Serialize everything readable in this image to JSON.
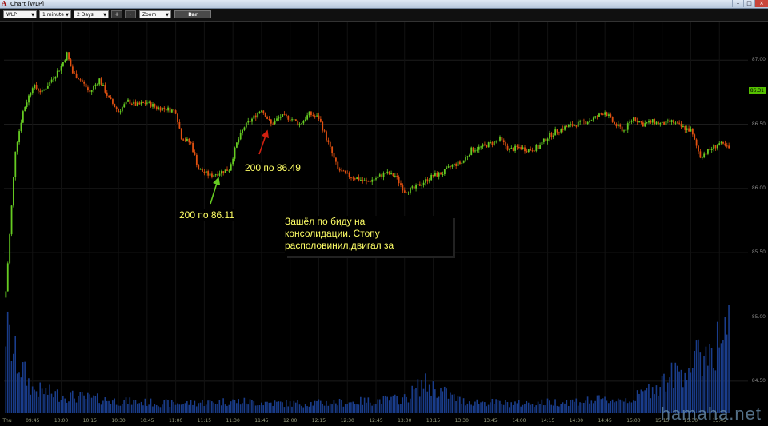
{
  "window": {
    "title": "Chart [WLP]",
    "minimize": "–",
    "maximize": "□",
    "close": "×"
  },
  "toolbar": {
    "symbol": "WLP",
    "interval": "1 minute",
    "range": "2 Days",
    "zoom_in": "+",
    "zoom_out": "-",
    "zoom": "Zoom",
    "chart_type": "Bar"
  },
  "price_axis": [
    "87.00",
    "86.50",
    "86.00",
    "85.50",
    "85.00",
    "84.50"
  ],
  "last_price": "86.31",
  "time_axis": [
    "Thu",
    "09:45",
    "10:00",
    "10:15",
    "10:30",
    "10:45",
    "11:00",
    "11:15",
    "11:30",
    "11:45",
    "12:00",
    "12:15",
    "12:30",
    "12:45",
    "13:00",
    "13:15",
    "13:30",
    "13:45",
    "14:00",
    "14:15",
    "14:30",
    "14:45",
    "15:00",
    "15:15",
    "15:30",
    "15:45"
  ],
  "annotations": {
    "buy": "200 по 86.11",
    "sell": "200 по 86.49",
    "comment_line1": "Зашёл по биду на",
    "comment_line2": "консолидации. Стопу",
    "comment_line3": "располовинил,двигал за"
  },
  "watermark": "hamaha.net",
  "colors": {
    "up": "#66cc22",
    "down": "#e05010",
    "volume": "#1a3d8c",
    "grid": "#1c1c1c",
    "note_text": "#ffff66"
  },
  "chart_data": {
    "type": "candlestick",
    "symbol": "WLP",
    "interval": "1 minute",
    "x_range": [
      "09:30",
      "16:00"
    ],
    "y_range": [
      84.25,
      87.3
    ],
    "y_ticks": [
      87.0,
      86.5,
      86.0,
      85.5,
      85.0,
      84.5
    ],
    "last_price": 86.31,
    "price_path": [
      [
        "09:31",
        85.2
      ],
      [
        "09:36",
        86.3
      ],
      [
        "09:40",
        86.6
      ],
      [
        "09:45",
        86.8
      ],
      [
        "09:50",
        86.75
      ],
      [
        "09:55",
        86.85
      ],
      [
        "10:00",
        86.95
      ],
      [
        "10:03",
        87.05
      ],
      [
        "10:06",
        86.9
      ],
      [
        "10:10",
        86.85
      ],
      [
        "10:15",
        86.75
      ],
      [
        "10:20",
        86.85
      ],
      [
        "10:25",
        86.7
      ],
      [
        "10:30",
        86.6
      ],
      [
        "10:35",
        86.68
      ],
      [
        "10:40",
        86.65
      ],
      [
        "10:45",
        86.67
      ],
      [
        "10:50",
        86.63
      ],
      [
        "10:55",
        86.62
      ],
      [
        "11:00",
        86.6
      ],
      [
        "11:03",
        86.4
      ],
      [
        "11:08",
        86.35
      ],
      [
        "11:12",
        86.15
      ],
      [
        "11:18",
        86.1
      ],
      [
        "11:22",
        86.12
      ],
      [
        "11:28",
        86.15
      ],
      [
        "11:32",
        86.35
      ],
      [
        "11:36",
        86.48
      ],
      [
        "11:42",
        86.57
      ],
      [
        "11:45",
        86.62
      ],
      [
        "11:50",
        86.5
      ],
      [
        "11:55",
        86.56
      ],
      [
        "12:00",
        86.55
      ],
      [
        "12:05",
        86.5
      ],
      [
        "12:10",
        86.58
      ],
      [
        "12:15",
        86.55
      ],
      [
        "12:20",
        86.35
      ],
      [
        "12:25",
        86.15
      ],
      [
        "12:30",
        86.1
      ],
      [
        "12:35",
        86.08
      ],
      [
        "12:40",
        86.05
      ],
      [
        "12:45",
        86.08
      ],
      [
        "12:50",
        86.12
      ],
      [
        "12:55",
        86.1
      ],
      [
        "13:00",
        85.98
      ],
      [
        "13:05",
        86.0
      ],
      [
        "13:10",
        86.05
      ],
      [
        "13:15",
        86.1
      ],
      [
        "13:20",
        86.12
      ],
      [
        "13:25",
        86.18
      ],
      [
        "13:30",
        86.2
      ],
      [
        "13:35",
        86.3
      ],
      [
        "13:40",
        86.32
      ],
      [
        "13:45",
        86.35
      ],
      [
        "13:50",
        86.38
      ],
      [
        "13:55",
        86.3
      ],
      [
        "14:00",
        86.32
      ],
      [
        "14:05",
        86.3
      ],
      [
        "14:10",
        86.32
      ],
      [
        "14:15",
        86.4
      ],
      [
        "14:20",
        86.45
      ],
      [
        "14:25",
        86.48
      ],
      [
        "14:30",
        86.5
      ],
      [
        "14:35",
        86.52
      ],
      [
        "14:40",
        86.55
      ],
      [
        "14:45",
        86.6
      ],
      [
        "14:50",
        86.5
      ],
      [
        "14:55",
        86.45
      ],
      [
        "15:00",
        86.55
      ],
      [
        "15:05",
        86.5
      ],
      [
        "15:10",
        86.52
      ],
      [
        "15:15",
        86.5
      ],
      [
        "15:20",
        86.52
      ],
      [
        "15:25",
        86.48
      ],
      [
        "15:30",
        86.45
      ],
      [
        "15:35",
        86.25
      ],
      [
        "15:40",
        86.3
      ],
      [
        "15:45",
        86.35
      ],
      [
        "15:50",
        86.31
      ]
    ],
    "volume_path": [
      [
        "09:31",
        0.7
      ],
      [
        "09:35",
        0.5
      ],
      [
        "09:45",
        0.2
      ],
      [
        "10:00",
        0.15
      ],
      [
        "10:30",
        0.1
      ],
      [
        "11:00",
        0.08
      ],
      [
        "11:30",
        0.1
      ],
      [
        "12:00",
        0.08
      ],
      [
        "12:30",
        0.09
      ],
      [
        "13:00",
        0.12
      ],
      [
        "13:10",
        0.25
      ],
      [
        "13:30",
        0.1
      ],
      [
        "14:00",
        0.08
      ],
      [
        "14:30",
        0.1
      ],
      [
        "15:00",
        0.12
      ],
      [
        "15:30",
        0.4
      ],
      [
        "15:45",
        0.6
      ],
      [
        "15:55",
        0.8
      ]
    ]
  }
}
